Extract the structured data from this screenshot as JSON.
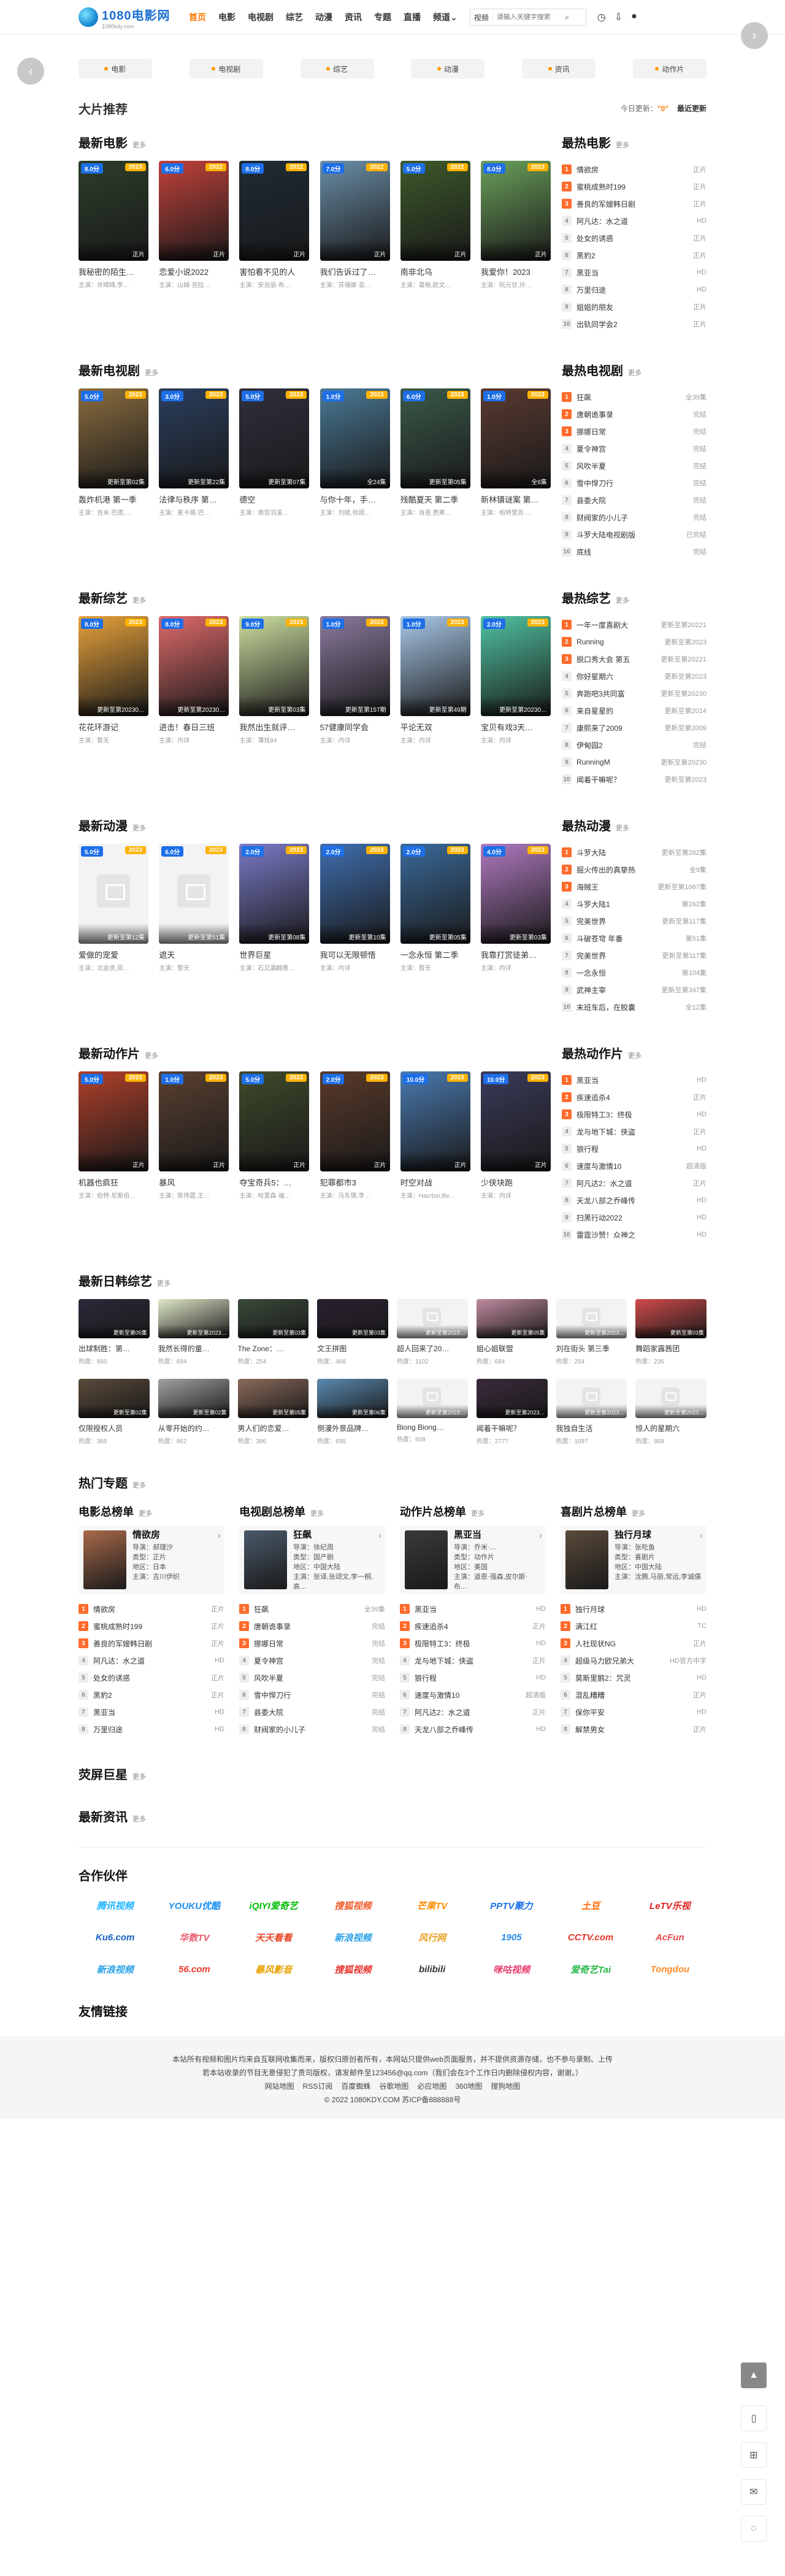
{
  "site": {
    "logo": "1080电影网",
    "logo_sub": "1080kdy.com"
  },
  "nav": [
    "首页",
    "电影",
    "电视剧",
    "综艺",
    "动漫",
    "资讯",
    "专题",
    "直播",
    "频道"
  ],
  "search": {
    "select": "视频",
    "placeholder": "请输入关键字搜索",
    "button": "搜索"
  },
  "catbar": [
    "电影",
    "电视剧",
    "综艺",
    "动漫",
    "资讯",
    "动作片"
  ],
  "featured": {
    "title": "大片推荐",
    "today_label": "今日更新：",
    "today_value": "\"0\"",
    "latest": "最近更新"
  },
  "more": "更多",
  "movies": {
    "title": "最新电影",
    "items": [
      {
        "t": "我秘密的陌生…",
        "a": "主演：许晴晴,李…",
        "s": "8.0分",
        "y": "2023",
        "st": "正片",
        "c": "#2c3e2a"
      },
      {
        "t": "恋爱小说2022",
        "a": "主演：山姆·克拉…",
        "s": "6.0分",
        "y": "2022",
        "st": "正片",
        "c": "#c2413a"
      },
      {
        "t": "害怕看不见的人",
        "a": "主演：安吉丽·布…",
        "s": "8.0分",
        "y": "2022",
        "st": "正片",
        "c": "#1e2b35"
      },
      {
        "t": "我们告诉过了…",
        "a": "主演：苏珊娜·亚…",
        "s": "7.0分",
        "y": "2022",
        "st": "正片",
        "c": "#6b8fa8"
      },
      {
        "t": "南非北乌",
        "a": "主演：葛格,欧文…",
        "s": "5.0分",
        "y": "2022",
        "st": "正片",
        "c": "#3d5a2a"
      },
      {
        "t": "我爱你！2023",
        "a": "主演：阮元甘,孙…",
        "s": "8.0分",
        "y": "2023",
        "st": "正片",
        "c": "#6aa05a"
      }
    ]
  },
  "movies_rank": {
    "title": "最热电影",
    "items": [
      {
        "n": "1",
        "t": "情欲房",
        "r": "正片"
      },
      {
        "n": "2",
        "t": "蜜桃成熟时199",
        "r": "正片"
      },
      {
        "n": "3",
        "t": "善良的军嫂韩日剧",
        "r": "正片"
      },
      {
        "n": "4",
        "t": "阿凡达：水之道",
        "r": "HD"
      },
      {
        "n": "5",
        "t": "处女的诱惑",
        "r": "正片"
      },
      {
        "n": "6",
        "t": "黑豹2",
        "r": "正片"
      },
      {
        "n": "7",
        "t": "黑亚当",
        "r": "HD"
      },
      {
        "n": "8",
        "t": "万里归途",
        "r": "HD"
      },
      {
        "n": "9",
        "t": "姐姐的朋友",
        "r": "正片"
      },
      {
        "n": "10",
        "t": "出轨同学会2",
        "r": "正片"
      }
    ]
  },
  "tv": {
    "title": "最新电视剧",
    "items": [
      {
        "t": "轰炸机港 第一季",
        "a": "主演：吉米·巴德,…",
        "s": "5.0分",
        "y": "2023",
        "st": "更新至第02集",
        "c": "#8b6d3f"
      },
      {
        "t": "法律与秩序 第…",
        "a": "主演：麦卡锡·巴…",
        "s": "3.0分",
        "y": "2023",
        "st": "更新至第22集",
        "c": "#2a3e5e"
      },
      {
        "t": "德空",
        "a": "主演：南宫羽溪…",
        "s": "5.0分",
        "y": "2023",
        "st": "更新至第07集",
        "c": "#2f2f3e"
      },
      {
        "t": "与你十年，手…",
        "a": "主演：刘姥,徐嫣…",
        "s": "1.0分",
        "y": "2023",
        "st": "全24集",
        "c": "#4a7a96"
      },
      {
        "t": "残酷夏天 第二季",
        "a": "主演：肖恩,费弗…",
        "s": "6.0分",
        "y": "2023",
        "st": "更新至第05集",
        "c": "#3a5a4a"
      },
      {
        "t": "新林镇谜案 第…",
        "a": "主演：帕特里克·…",
        "s": "1.0分",
        "y": "2023",
        "st": "全6集",
        "c": "#5a3a30"
      }
    ]
  },
  "tv_rank": {
    "title": "最热电视剧",
    "items": [
      {
        "n": "1",
        "t": "狂飙",
        "r": "全39集"
      },
      {
        "n": "2",
        "t": "唐朝诡事录",
        "r": "完结"
      },
      {
        "n": "3",
        "t": "挪娜日常",
        "r": "完结"
      },
      {
        "n": "4",
        "t": "夏令神宫",
        "r": "完结"
      },
      {
        "n": "5",
        "t": "风吹半夏",
        "r": "完结"
      },
      {
        "n": "6",
        "t": "雪中悍刀行",
        "r": "完结"
      },
      {
        "n": "7",
        "t": "县委大院",
        "r": "完结"
      },
      {
        "n": "8",
        "t": "财阀家的小儿子",
        "r": "完结"
      },
      {
        "n": "9",
        "t": "斗罗大陆电视剧版",
        "r": "已完结"
      },
      {
        "n": "10",
        "t": "底线",
        "r": "完结"
      }
    ]
  },
  "variety": {
    "title": "最新综艺",
    "items": [
      {
        "t": "花花环游记",
        "a": "主演：暂无",
        "s": "8.0分",
        "y": "2023",
        "st": "更新至第20230…",
        "c": "#e8a23a"
      },
      {
        "t": "进击！春日三班",
        "a": "主演：内详",
        "s": "8.0分",
        "y": "2023",
        "st": "更新至第20230…",
        "c": "#e06a6a"
      },
      {
        "t": "我然出生就评…",
        "a": "主演：薄技84",
        "s": "9.0分",
        "y": "2023",
        "st": "更新至第03集",
        "c": "#cde0a0"
      },
      {
        "t": "57健康同学会",
        "a": "主演：内详",
        "s": "1.0分",
        "y": "2023",
        "st": "更新至第157期",
        "c": "#8a7a9e"
      },
      {
        "t": "平论无双",
        "a": "主演：内详",
        "s": "1.0分",
        "y": "2023",
        "st": "更新至第49期",
        "c": "#a8c8e8"
      },
      {
        "t": "宝贝有戏3天…",
        "a": "主演：内详",
        "s": "2.0分",
        "y": "2023",
        "st": "更新至第20230…",
        "c": "#4fc3a1"
      }
    ]
  },
  "variety_rank": {
    "title": "最热综艺",
    "items": [
      {
        "n": "1",
        "t": "一年一度喜剧大",
        "r": "更新至第20221"
      },
      {
        "n": "2",
        "t": "Running",
        "r": "更新至第2023"
      },
      {
        "n": "3",
        "t": "脱口秀大会 第五",
        "r": "更新至第20221"
      },
      {
        "n": "4",
        "t": "你好星期六",
        "r": "更新至第2023"
      },
      {
        "n": "5",
        "t": "奔跑吧3共同富",
        "r": "更新至第20230"
      },
      {
        "n": "6",
        "t": "来自星星的",
        "r": "更新至第2014"
      },
      {
        "n": "7",
        "t": "康熙来了2009",
        "r": "更新至第2009"
      },
      {
        "n": "8",
        "t": "伊甸园2",
        "r": "完结"
      },
      {
        "n": "9",
        "t": "RunningM",
        "r": "更新至第20230"
      },
      {
        "n": "10",
        "t": "闻着干嘛呢？",
        "r": "更新至第2023"
      }
    ]
  },
  "anime": {
    "title": "最新动漫",
    "items": [
      {
        "t": "爱做的宠爱",
        "a": "主演：北金虎,吴…",
        "s": "5.0分",
        "y": "2023",
        "st": "更新至第12集",
        "c": ""
      },
      {
        "t": "遮天",
        "a": "主演：暂无",
        "s": "6.0分",
        "y": "2023",
        "st": "更新至第51集",
        "c": ""
      },
      {
        "t": "世界巨星",
        "a": "主演：石见漏翻香…",
        "s": "2.0分",
        "y": "2023",
        "st": "更新至第08集",
        "c": "#7a7ac8"
      },
      {
        "t": "我可以无限顿悟",
        "a": "主演：内详",
        "s": "2.0分",
        "y": "2023",
        "st": "更新至第10集",
        "c": "#3f6fb0"
      },
      {
        "t": "一念永恒 第二季",
        "a": "主演：暂无",
        "s": "2.0分",
        "y": "2023",
        "st": "更新至第05集",
        "c": "#3a6a9a"
      },
      {
        "t": "我靠打赏徒弟…",
        "a": "主演：内详",
        "s": "4.0分",
        "y": "2023",
        "st": "更新至第03集",
        "c": "#b07ac0"
      }
    ]
  },
  "anime_rank": {
    "title": "最热动漫",
    "items": [
      {
        "n": "1",
        "t": "斗罗大陆",
        "r": "更新至第262集"
      },
      {
        "n": "2",
        "t": "掘火传出的真挚热",
        "r": "全9集"
      },
      {
        "n": "3",
        "t": "海贼王",
        "r": "更新至第1067集"
      },
      {
        "n": "4",
        "t": "斗罗大陆1",
        "r": "第262集"
      },
      {
        "n": "5",
        "t": "完美世界",
        "r": "更新至第117集"
      },
      {
        "n": "6",
        "t": "斗破苍穹 年番",
        "r": "第51集"
      },
      {
        "n": "7",
        "t": "完美世界",
        "r": "更新至第117集"
      },
      {
        "n": "8",
        "t": "一念永恒",
        "r": "第104集"
      },
      {
        "n": "9",
        "t": "武神主宰",
        "r": "更新至第347集"
      },
      {
        "n": "10",
        "t": "末班车后，在胶囊",
        "r": "全12集"
      }
    ]
  },
  "action": {
    "title": "最新动作片",
    "items": [
      {
        "t": "机器也疯狂",
        "a": "主演：伯特·尼斯伯…",
        "s": "5.0分",
        "y": "2023",
        "st": "正片",
        "c": "#b0402a"
      },
      {
        "t": "暴风",
        "a": "主演：陈伟霆,王…",
        "s": "1.0分",
        "y": "2023",
        "st": "正片",
        "c": "#5a4030"
      },
      {
        "t": "夺宝奇兵5：…",
        "a": "主演：哈里森·福…",
        "s": "5.0分",
        "y": "2023",
        "st": "正片",
        "c": "#3e4a2a"
      },
      {
        "t": "犯罪都市3",
        "a": "主演：马东锡,李…",
        "s": "2.0分",
        "y": "2023",
        "st": "正片",
        "c": "#5a3a2a"
      },
      {
        "t": "时空对战",
        "a": "主演：Hacrton,Be…",
        "s": "10.0分",
        "y": "2023",
        "st": "正片",
        "c": "#4a7ab0"
      },
      {
        "t": "少侠块跑",
        "a": "主演：内详",
        "s": "10.0分",
        "y": "2023",
        "st": "正片",
        "c": "#3a3a5a"
      }
    ]
  },
  "action_rank": {
    "title": "最热动作片",
    "items": [
      {
        "n": "1",
        "t": "黑亚当",
        "r": "HD"
      },
      {
        "n": "2",
        "t": "疾速追杀4",
        "r": "正片"
      },
      {
        "n": "3",
        "t": "极限特工3：终极",
        "r": "HD"
      },
      {
        "n": "4",
        "t": "龙与地下城：侠盗",
        "r": "正片"
      },
      {
        "n": "5",
        "t": "狼行程",
        "r": "HD"
      },
      {
        "n": "6",
        "t": "速度与激情10",
        "r": "超清版"
      },
      {
        "n": "7",
        "t": "阿凡达2：水之道",
        "r": "正片"
      },
      {
        "n": "8",
        "t": "天龙八部之乔峰传",
        "r": "HD"
      },
      {
        "n": "9",
        "t": "扫黑行动2022",
        "r": "HD"
      },
      {
        "n": "10",
        "t": "雷霆沙赞！众神之",
        "r": "HD"
      }
    ]
  },
  "jk": {
    "title": "最新日韩综艺",
    "items": [
      {
        "t": "出球制胜：第…",
        "a": "热度：660",
        "st": "更新至第05集",
        "c": "#2a2a3a"
      },
      {
        "t": "我然长得的童…",
        "a": "热度：694",
        "st": "更新至第2023…",
        "c": "#dfe8c8"
      },
      {
        "t": "The Zone：…",
        "a": "热度：254",
        "st": "更新至第03集",
        "c": "#3a4a3a"
      },
      {
        "t": "文王拼图",
        "a": "热度：468",
        "st": "更新至第03集",
        "c": "#2a2030"
      },
      {
        "t": "超人回来了20…",
        "a": "热度：1102",
        "st": "更新至第2023…",
        "c": ""
      },
      {
        "t": "姐心姐联盟",
        "a": "热度：684",
        "st": "更新至第05集",
        "c": "#c08aa0"
      },
      {
        "t": "刘在街头 第三季",
        "a": "热度：254",
        "st": "更新至第2023…",
        "c": ""
      },
      {
        "t": "舞蹈家露茜团",
        "a": "热度：236",
        "st": "更新至第03集",
        "c": "#d04a4a"
      },
      {
        "t": "仅限授权人员",
        "a": "热度：385",
        "st": "更新至第02集",
        "c": "#5a4a3a"
      },
      {
        "t": "从零开始的约…",
        "a": "热度：862",
        "st": "更新至第02集",
        "c": "#a0a0a0"
      },
      {
        "t": "男人们的恋爱…",
        "a": "热度：386",
        "st": "更新至第05集",
        "c": "#8a6a5a"
      },
      {
        "t": "侧漫外景品牌…",
        "a": "热度：695",
        "st": "更新至第06集",
        "c": "#5a8ab0"
      },
      {
        "t": "Biong Biong…",
        "a": "热度：609",
        "st": "更新至第2023…",
        "c": ""
      },
      {
        "t": "闻着干嘛呢？",
        "a": "热度：2777",
        "st": "更新至第2023…",
        "c": "#3a2a3a"
      },
      {
        "t": "我独自生活",
        "a": "热度：1097",
        "st": "更新至第2023…",
        "c": ""
      },
      {
        "t": "惊人的星期六",
        "a": "热度：868",
        "st": "更新至第2023…",
        "c": ""
      }
    ]
  },
  "topics": {
    "title": "热门专题",
    "cols": [
      {
        "title": "电影总榜单",
        "ft": "情欲房",
        "fl": [
          "导演：郝理汐",
          "类型：正片",
          "地区：日本",
          "主演：吉川伊织"
        ],
        "c": "#a86a4a",
        "items": [
          {
            "n": "1",
            "t": "情欲房",
            "r": "正片"
          },
          {
            "n": "2",
            "t": "蜜桃成熟时199",
            "r": "正片"
          },
          {
            "n": "3",
            "t": "善良的军嫂韩日剧",
            "r": "正片"
          },
          {
            "n": "4",
            "t": "阿凡达：水之道",
            "r": "HD"
          },
          {
            "n": "5",
            "t": "处女的诱惑",
            "r": "正片"
          },
          {
            "n": "6",
            "t": "黑豹2",
            "r": "正片"
          },
          {
            "n": "7",
            "t": "黑亚当",
            "r": "HD"
          },
          {
            "n": "8",
            "t": "万里归途",
            "r": "HD"
          }
        ]
      },
      {
        "title": "电视剧总榜单",
        "ft": "狂飙",
        "fl": [
          "导演：徐纪周",
          "类型：国产剧",
          "地区：中国大陆",
          "主演：张译,张颂文,李一桐,高…"
        ],
        "c": "#4a5a6a",
        "items": [
          {
            "n": "1",
            "t": "狂飙",
            "r": "全39集"
          },
          {
            "n": "2",
            "t": "唐朝诡事录",
            "r": "完结"
          },
          {
            "n": "3",
            "t": "挪娜日常",
            "r": "完结"
          },
          {
            "n": "4",
            "t": "夏令神宫",
            "r": "完结"
          },
          {
            "n": "5",
            "t": "风吹半夏",
            "r": "完结"
          },
          {
            "n": "6",
            "t": "雪中悍刀行",
            "r": "完结"
          },
          {
            "n": "7",
            "t": "县委大院",
            "r": "完结"
          },
          {
            "n": "8",
            "t": "财阀家的小儿子",
            "r": "完结"
          }
        ]
      },
      {
        "title": "动作片总榜单",
        "ft": "黑亚当",
        "fl": [
          "导演：乔米·…",
          "类型：动作片",
          "地区：美国",
          "主演：道恩·强森,皮尔斯·布…"
        ],
        "c": "#3a3a3a",
        "items": [
          {
            "n": "1",
            "t": "黑亚当",
            "r": "HD"
          },
          {
            "n": "2",
            "t": "疾速追杀4",
            "r": "正片"
          },
          {
            "n": "3",
            "t": "极限特工3：终极",
            "r": "HD"
          },
          {
            "n": "4",
            "t": "龙与地下城：侠盗",
            "r": "正片"
          },
          {
            "n": "5",
            "t": "狼行程",
            "r": "HD"
          },
          {
            "n": "6",
            "t": "速度与激情10",
            "r": "超清版"
          },
          {
            "n": "7",
            "t": "阿凡达2：水之道",
            "r": "正片"
          },
          {
            "n": "8",
            "t": "天龙八部之乔峰传",
            "r": "HD"
          }
        ]
      },
      {
        "title": "喜剧片总榜单",
        "ft": "独行月球",
        "fl": [
          "导演：张吃鱼",
          "类型：喜剧片",
          "地区：中国大陆",
          "主演：沈腾,马丽,常远,李诚儒"
        ],
        "c": "#5a4a3a",
        "items": [
          {
            "n": "1",
            "t": "独行月球",
            "r": "HD"
          },
          {
            "n": "2",
            "t": "满江红",
            "r": "TC"
          },
          {
            "n": "3",
            "t": "人社现状NG",
            "r": "正片"
          },
          {
            "n": "4",
            "t": "超级马力欧兄弟大",
            "r": "HD官方中字"
          },
          {
            "n": "5",
            "t": "莫斯里鹅2：咒灵",
            "r": "HD"
          },
          {
            "n": "6",
            "t": "混乱糟糟",
            "r": "正片"
          },
          {
            "n": "7",
            "t": "保你平安",
            "r": "HD"
          },
          {
            "n": "8",
            "t": "解禁男女",
            "r": "正片"
          }
        ]
      }
    ]
  },
  "stars": {
    "title": "荧屏巨星"
  },
  "news": {
    "title": "最新资讯"
  },
  "partners": {
    "title": "合作伙伴",
    "logos": [
      {
        "t": "腾讯视频",
        "c": "#1eb4ff"
      },
      {
        "t": "YOUKU优酷",
        "c": "#1c8ff0"
      },
      {
        "t": "iQIYI爱奇艺",
        "c": "#00be06"
      },
      {
        "t": "搜狐视频",
        "c": "#f05a28"
      },
      {
        "t": "芒果TV",
        "c": "#ff8a00"
      },
      {
        "t": "PPTV聚力",
        "c": "#1a72e8"
      },
      {
        "t": "土豆",
        "c": "#ff6a00"
      },
      {
        "t": "LeTV乐视",
        "c": "#e02020"
      },
      {
        "t": "Ku6.com",
        "c": "#1a60c8"
      },
      {
        "t": "华数TV",
        "c": "#e85a6a"
      },
      {
        "t": "天天看看",
        "c": "#e84a2a"
      },
      {
        "t": "新浪视频",
        "c": "#2aa0e8"
      },
      {
        "t": "风行网",
        "c": "#e8a020"
      },
      {
        "t": "1905",
        "c": "#2a8ae8"
      },
      {
        "t": "CCTV.com",
        "c": "#e03a2a"
      },
      {
        "t": "AcFun",
        "c": "#e84a4a"
      },
      {
        "t": "新浪视频",
        "c": "#2aa0e8"
      },
      {
        "t": "56.com",
        "c": "#e83a2a"
      },
      {
        "t": "暴风影音",
        "c": "#e8a000"
      },
      {
        "t": "搜狐视频",
        "c": "#e8302a"
      },
      {
        "t": "bilibili",
        "c": "#333333"
      },
      {
        "t": "咪咕视频",
        "c": "#e83a6a"
      },
      {
        "t": "爱奇艺Tai",
        "c": "#2ab84a"
      },
      {
        "t": "Tongdou",
        "c": "#ff8a2a"
      }
    ]
  },
  "friends": {
    "title": "友情链接"
  },
  "footer": {
    "notice": "本站所有视频和图片均来自互联网收集而来，版权归原创者所有，本网站只提供web页面服务，并不提供资源存储，也不参与录制、上传",
    "notice2": "若本站收录的节目无意侵犯了贵司版权，请发邮件至123456@qq.com（我们会在3个工作日内删除侵权内容，谢谢。）",
    "links": [
      "网站地图",
      "RSS订阅",
      "百度蜘蛛",
      "谷歌地图",
      "必应地图",
      "360地图",
      "搜狗地图"
    ],
    "copy": "© 2022 1080KDY.COM 苏ICP备888888号"
  }
}
